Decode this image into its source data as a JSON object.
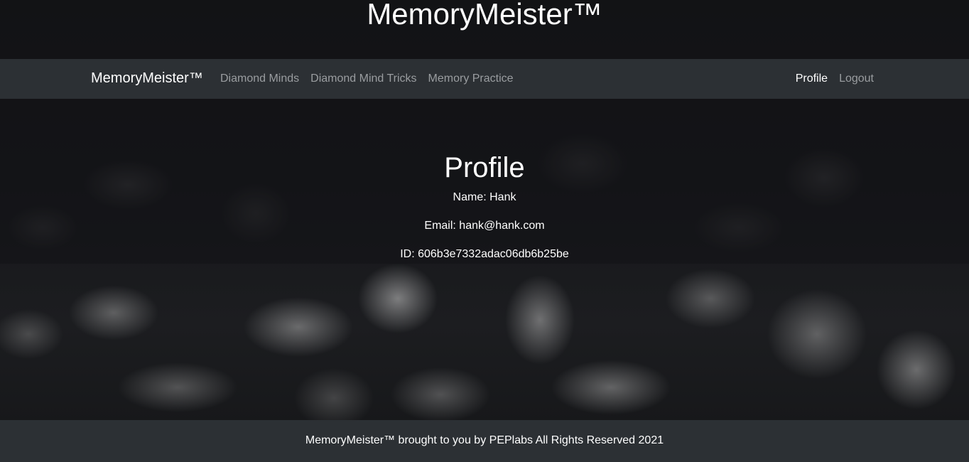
{
  "site": {
    "title": "MemoryMeister™"
  },
  "navbar": {
    "brand": "MemoryMeister™",
    "left_links": [
      {
        "label": "Diamond Minds"
      },
      {
        "label": "Diamond Mind Tricks"
      },
      {
        "label": "Memory Practice"
      }
    ],
    "right_links": [
      {
        "label": "Profile",
        "active": true
      },
      {
        "label": "Logout",
        "active": false
      }
    ]
  },
  "profile": {
    "heading": "Profile",
    "name_label": "Name:",
    "name": "Hank",
    "email_label": "Email:",
    "email": "hank@hank.com",
    "id_label": "ID:",
    "id": "606b3e7332adac06db6b25be"
  },
  "footer": {
    "text": "MemoryMeister™ brought to you by PEPlabs All Rights Reserved 2021"
  },
  "colors": {
    "navbar_bg": "#2c3034",
    "footer_bg": "#2c3034",
    "nav_link": "#9a9da0",
    "nav_link_active": "#ffffff",
    "page_bg": "#16171a"
  }
}
